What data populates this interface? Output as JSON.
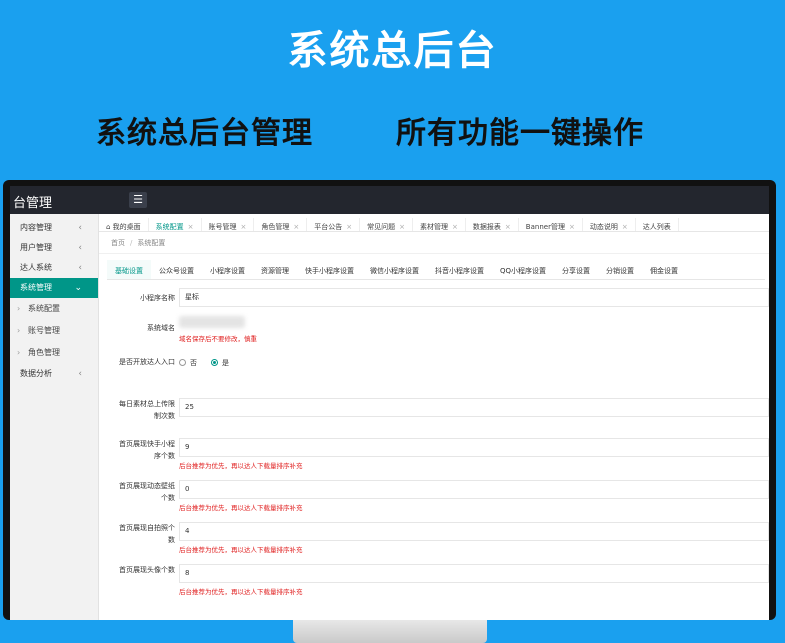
{
  "hero": {
    "title": "系统总后台",
    "subtitle_left": "系统总后台管理",
    "subtitle_right": "所有功能一键操作"
  },
  "topbar": {
    "brand": "台管理",
    "menu_icon": "☰"
  },
  "sidebar": {
    "items": [
      {
        "label": "内容管理",
        "chev": "‹"
      },
      {
        "label": "用户管理",
        "chev": "‹"
      },
      {
        "label": "达人系统",
        "chev": "‹"
      },
      {
        "label": "系统管理",
        "chev": "⌄"
      }
    ],
    "subitems": [
      {
        "label": "系统配置"
      },
      {
        "label": "账号管理"
      },
      {
        "label": "角色管理"
      }
    ],
    "last": {
      "label": "数据分析",
      "chev": "‹"
    }
  },
  "tabs": [
    {
      "label": "⌂ 我的桌面"
    },
    {
      "label": "系统配置"
    },
    {
      "label": "账号管理"
    },
    {
      "label": "角色管理"
    },
    {
      "label": "平台公告"
    },
    {
      "label": "常见问题"
    },
    {
      "label": "素材管理"
    },
    {
      "label": "数据报表"
    },
    {
      "label": "Banner管理"
    },
    {
      "label": "动态说明"
    },
    {
      "label": "达人列表"
    }
  ],
  "breadcrumb": {
    "home": "首页",
    "current": "系统配置"
  },
  "subtabs": [
    "基础设置",
    "公众号设置",
    "小程序设置",
    "资源管理",
    "快手小程序设置",
    "微信小程序设置",
    "抖音小程序设置",
    "QQ小程序设置",
    "分享设置",
    "分销设置",
    "佣金设置"
  ],
  "form": {
    "name_label": "小程序名称",
    "name_value": "星标",
    "domain_label": "系统域名",
    "domain_hint": "域名保存后不要修改，慎重",
    "open_label": "是否开放达人入口",
    "open_no": "否",
    "open_yes": "是",
    "daily_label": "每日素材总上传限制次数",
    "daily_value": "25",
    "home_a_label": "首页展现快手小程序个数",
    "home_a_value": "9",
    "home_a_hint": "后台推荐为优先，再以达人下载量排序补充",
    "home_b_label": "首页展现动态壁纸个数",
    "home_b_value": "0",
    "home_b_hint": "后台推荐为优先，再以达人下载量排序补充",
    "home_c_label": "首页展现自拍照个数",
    "home_c_value": "4",
    "home_c_hint": "后台推荐为优先，再以达人下载量排序补充",
    "home_d_label": "首页展现头像个数",
    "home_d_value": "8",
    "home_d_hint": "后台推荐为优先，再以达人下载量排序补充"
  }
}
